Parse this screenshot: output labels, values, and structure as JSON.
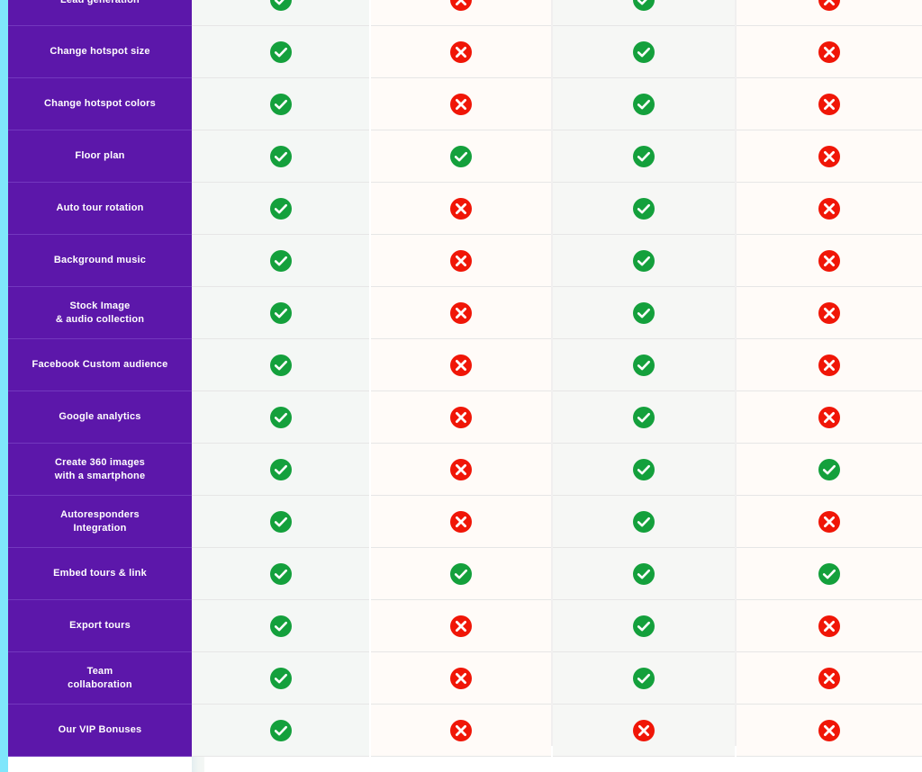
{
  "table": {
    "accent_color": "#7FE6FB",
    "feature_column_color": "#5C17AA",
    "yes_color": "#14A03C",
    "no_color": "#F01607",
    "yes_icon": "check-circle-icon",
    "no_icon": "x-circle-icon",
    "columns": [
      {
        "id": "col-1",
        "tint": "#F4F7F5"
      },
      {
        "id": "col-2",
        "tint": "#FFFBF8"
      },
      {
        "id": "col-3",
        "tint": "#F6F7F5"
      },
      {
        "id": "col-4",
        "tint": "#FFFBF8"
      }
    ],
    "rows": [
      {
        "label": "Lead generation",
        "values": [
          "yes",
          "no",
          "yes",
          "no"
        ]
      },
      {
        "label": "Change hotspot size",
        "values": [
          "yes",
          "no",
          "yes",
          "no"
        ]
      },
      {
        "label": "Change hotspot colors",
        "values": [
          "yes",
          "no",
          "yes",
          "no"
        ]
      },
      {
        "label": "Floor plan",
        "values": [
          "yes",
          "yes",
          "yes",
          "no"
        ]
      },
      {
        "label": "Auto tour rotation",
        "values": [
          "yes",
          "no",
          "yes",
          "no"
        ]
      },
      {
        "label": "Background music",
        "values": [
          "yes",
          "no",
          "yes",
          "no"
        ]
      },
      {
        "label": "Stock Image\n& audio collection",
        "values": [
          "yes",
          "no",
          "yes",
          "no"
        ]
      },
      {
        "label": "Facebook Custom audience",
        "values": [
          "yes",
          "no",
          "yes",
          "no"
        ]
      },
      {
        "label": "Google analytics",
        "values": [
          "yes",
          "no",
          "yes",
          "no"
        ]
      },
      {
        "label": "Create 360 images\nwith a smartphone",
        "values": [
          "yes",
          "no",
          "yes",
          "yes"
        ]
      },
      {
        "label": "Autoresponders\nIntegration",
        "values": [
          "yes",
          "no",
          "yes",
          "no"
        ]
      },
      {
        "label": "Embed tours & link",
        "values": [
          "yes",
          "yes",
          "yes",
          "yes"
        ]
      },
      {
        "label": "Export tours",
        "values": [
          "yes",
          "no",
          "yes",
          "no"
        ]
      },
      {
        "label": "Team\ncollaboration",
        "values": [
          "yes",
          "no",
          "yes",
          "no"
        ]
      },
      {
        "label": "Our VIP Bonuses",
        "values": [
          "yes",
          "no",
          "no",
          "no"
        ]
      }
    ]
  }
}
